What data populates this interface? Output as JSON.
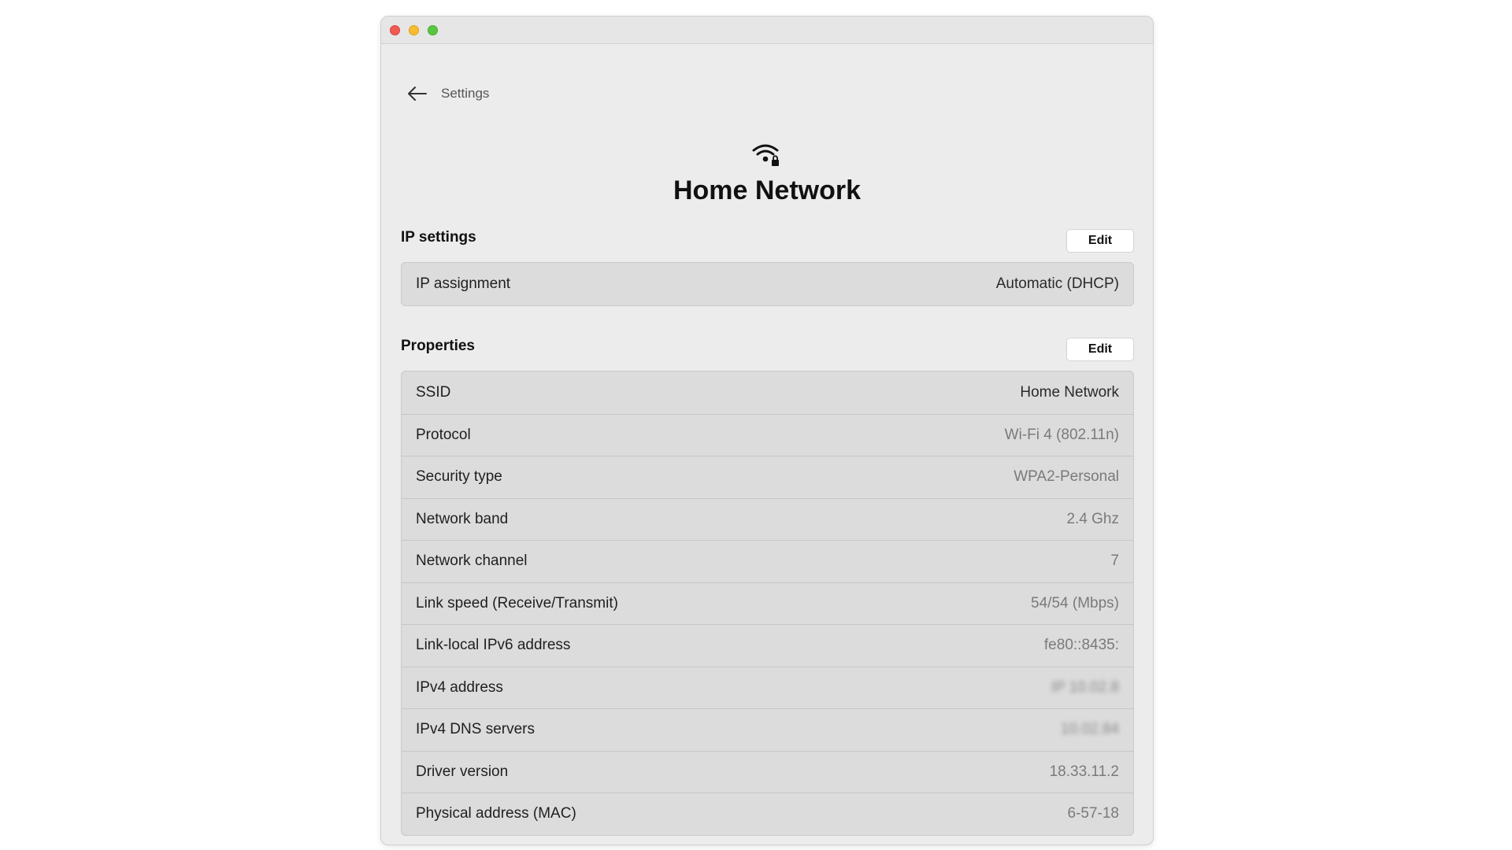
{
  "window": {
    "title": "Home Network"
  },
  "nav": {
    "back_icon": "arrow-left-icon",
    "label": "Settings"
  },
  "header": {
    "icon": "wifi-lock-icon",
    "title": "Home Network"
  },
  "ip_settings": {
    "title": "IP settings",
    "edit_label": "Edit",
    "rows": [
      {
        "label": "IP assignment",
        "value": "Automatic (DHCP)"
      }
    ]
  },
  "properties": {
    "title": "Properties",
    "edit_label": "Edit",
    "rows": [
      {
        "label": "SSID",
        "value": "Home Network"
      },
      {
        "label": "Protocol",
        "value": "Wi-Fi 4 (802.11n)"
      },
      {
        "label": "Security type",
        "value": "WPA2-Personal"
      },
      {
        "label": "Network band",
        "value": "2.4 Ghz"
      },
      {
        "label": "Network channel",
        "value": "7"
      },
      {
        "label": "Link speed (Receive/Transmit)",
        "value": "54/54 (Mbps)"
      },
      {
        "label": "Link-local IPv6 address",
        "value": "fe80::8435:"
      },
      {
        "label": "IPv4 address",
        "value": "IP 10.02.8"
      },
      {
        "label": "IPv4 DNS servers",
        "value": "10.02.84"
      },
      {
        "label": "Driver version",
        "value": "18.33.11.2"
      },
      {
        "label": "Physical address (MAC)",
        "value": "6-57-18"
      }
    ]
  },
  "colors": {
    "window_bg": "#ececec",
    "card_bg": "#dcdcdc",
    "close": "#ee5b52",
    "minimize": "#f5bd2f",
    "maximize": "#5ac541"
  }
}
